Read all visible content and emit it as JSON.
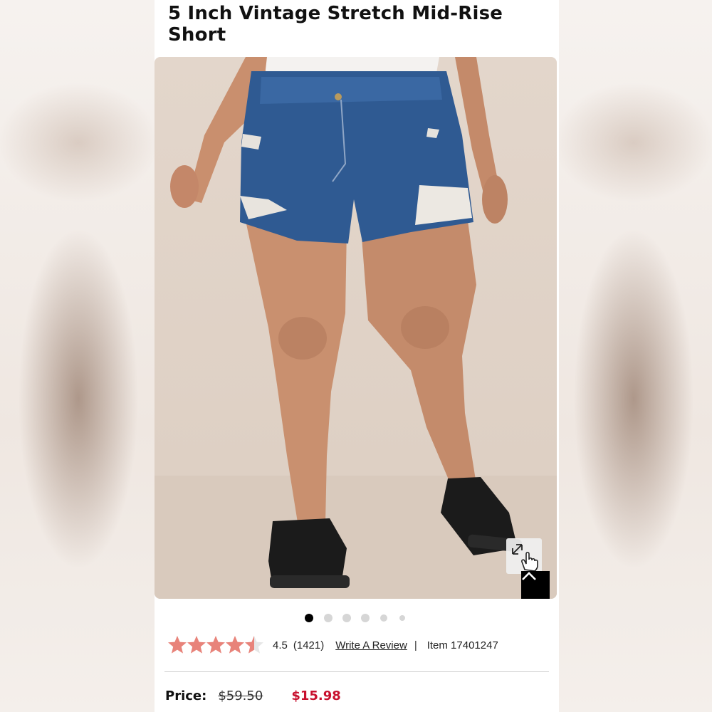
{
  "product": {
    "title": "5 Inch Vintage Stretch Mid-Rise Short"
  },
  "gallery": {
    "image_alt": "Model wearing distressed denim mid-rise shorts with black sneakers",
    "slide_count": 6,
    "active_slide": 1,
    "zoom_icon": "expand-icon",
    "top_icon": "chevron-up-icon"
  },
  "rating": {
    "value": "4.5",
    "count": "(1421)",
    "stars_filled": 4.5,
    "stars_max": 5,
    "write_review": "Write A Review",
    "separator": "|",
    "item_label": "Item 17401247"
  },
  "price": {
    "label": "Price:",
    "original": "$59.50",
    "sale": "$15.98"
  },
  "colors": {
    "star": "#e8837a",
    "sale": "#c8102e",
    "active_dot": "#000000"
  }
}
